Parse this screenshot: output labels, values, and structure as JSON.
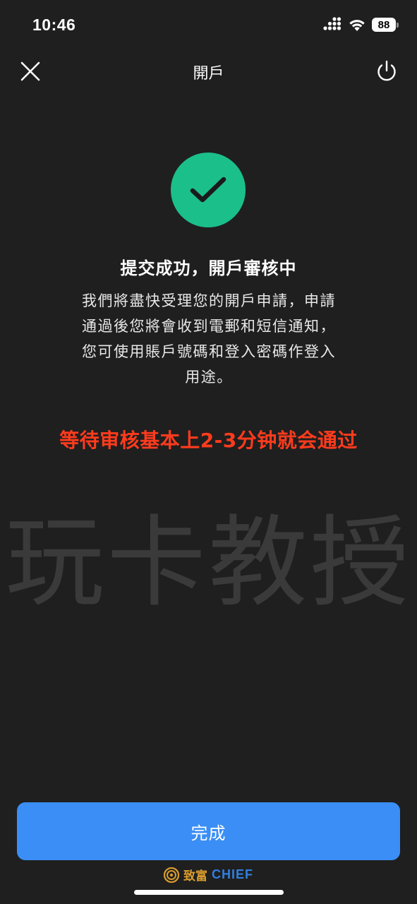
{
  "status_bar": {
    "time": "10:46",
    "battery": "88",
    "icons": [
      "signal-icon",
      "wifi-icon",
      "battery-icon"
    ]
  },
  "nav": {
    "title": "開戶",
    "left_icon": "close-icon",
    "right_icon": "power-icon"
  },
  "success": {
    "icon": "check-icon",
    "title": "提交成功，開戶審核中",
    "description_lines": [
      "我們將盡快受理您的開戶申請，申請",
      "通過後您將會收到電郵和短信通知，",
      "您可使用賬戶號碼和登入密碼作登入",
      "用途。"
    ]
  },
  "annotation": "等待审核基本上2-3分钟就会通过",
  "watermark": "玩卡教授",
  "done_button": {
    "label": "完成"
  },
  "brand": {
    "cn": "致富",
    "en": "CHIEF",
    "icon": "brand-logo-icon"
  },
  "colors": {
    "background": "#1f1f1f",
    "success_green": "#1bbf8a",
    "primary_blue": "#3a8ef5",
    "annotation_red": "#ff3b1d",
    "brand_gold": "#d89c2e",
    "brand_blue": "#2f7fe0"
  }
}
